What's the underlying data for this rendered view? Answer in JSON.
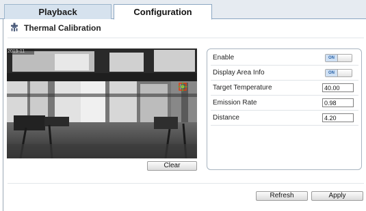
{
  "tabs": [
    {
      "label": "Playback"
    },
    {
      "label": "Configuration"
    }
  ],
  "section": {
    "title": "Thermal Calibration",
    "icon": "thermometer-icon"
  },
  "video": {
    "timestamp_overlay": "2019-11"
  },
  "clear_label": "Clear",
  "settings": {
    "enable": {
      "label": "Enable",
      "state": "ON"
    },
    "display_area_info": {
      "label": "Display Area Info",
      "state": "ON"
    },
    "target_temperature": {
      "label": "Target Temperature",
      "value": "40.00"
    },
    "emission_rate": {
      "label": "Emission Rate",
      "value": "0.98"
    },
    "distance": {
      "label": "Distance",
      "value": "4.20"
    }
  },
  "footer": {
    "refresh_label": "Refresh",
    "apply_label": "Apply"
  },
  "colors": {
    "active_tab_bg": "#ffffff",
    "tab_bar_bg": "#e6ebf1",
    "toggle_on": "#cfe0f3",
    "marker": "#e04010"
  }
}
